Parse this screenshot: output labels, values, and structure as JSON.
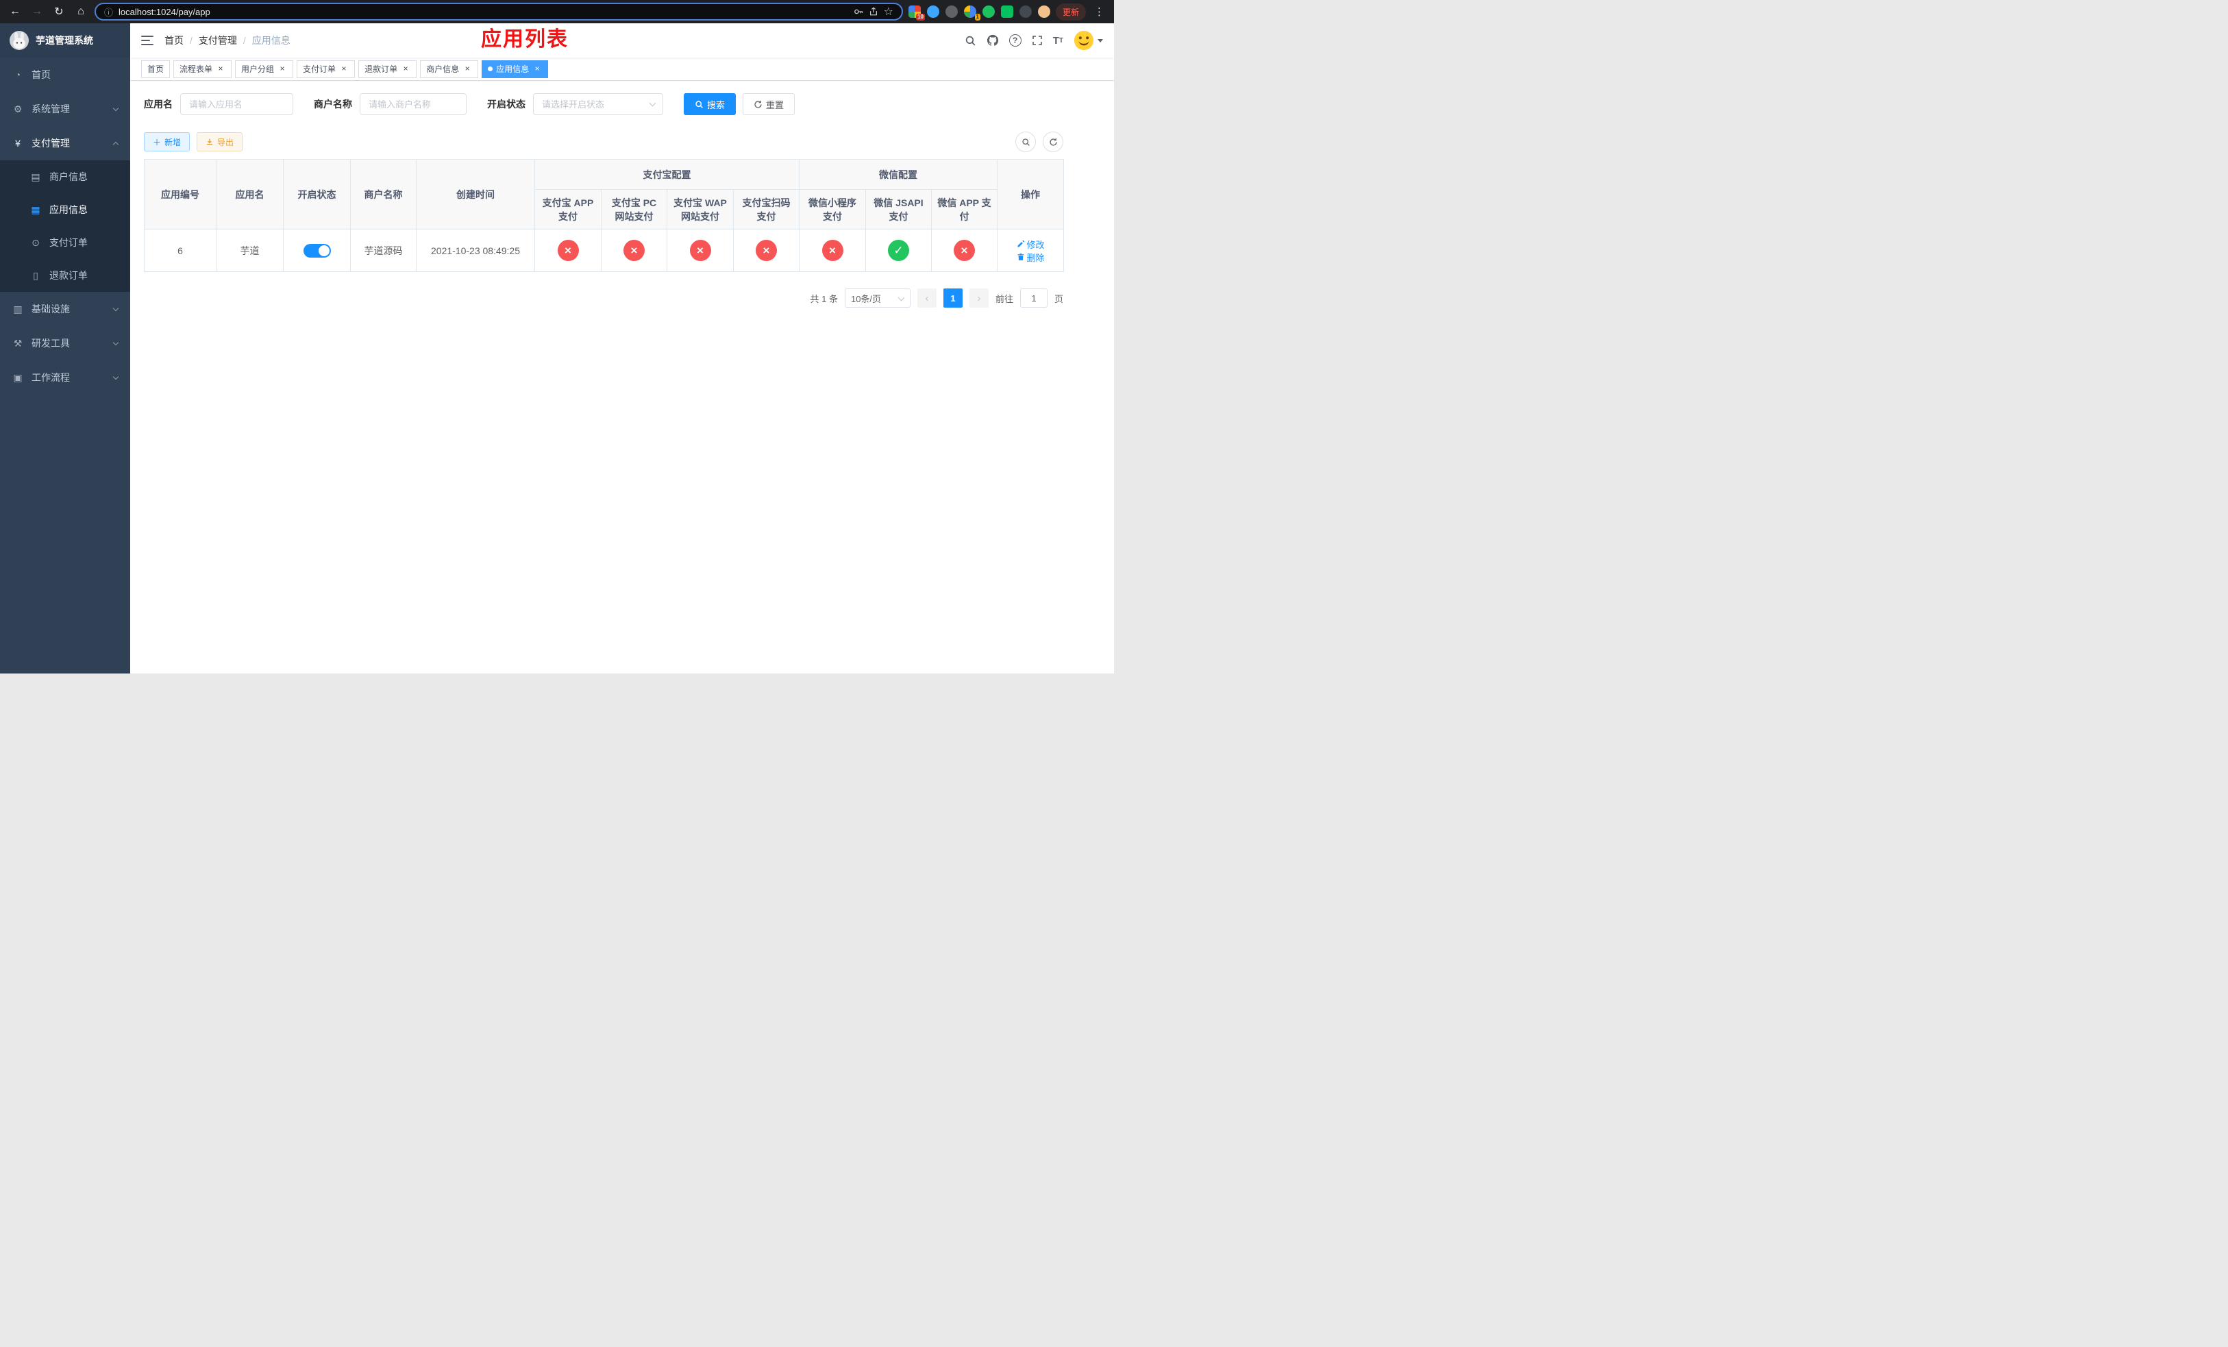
{
  "browser": {
    "url": "localhost:1024/pay/app",
    "update_label": "更新",
    "extension_badge_tabs": "10",
    "extension_badge_translate": "1"
  },
  "app": {
    "title": "芋道管理系统"
  },
  "sidebar": {
    "items": [
      {
        "label": "首页"
      },
      {
        "label": "系统管理"
      },
      {
        "label": "支付管理",
        "children": [
          {
            "label": "商户信息"
          },
          {
            "label": "应用信息"
          },
          {
            "label": "支付订单"
          },
          {
            "label": "退款订单"
          }
        ]
      },
      {
        "label": "基础设施"
      },
      {
        "label": "研发工具"
      },
      {
        "label": "工作流程"
      }
    ]
  },
  "header": {
    "breadcrumb": [
      "首页",
      "支付管理",
      "应用信息"
    ],
    "overlay_title": "应用列表"
  },
  "tabs": [
    {
      "label": "首页"
    },
    {
      "label": "流程表单"
    },
    {
      "label": "用户分组"
    },
    {
      "label": "支付订单"
    },
    {
      "label": "退款订单"
    },
    {
      "label": "商户信息"
    },
    {
      "label": "应用信息"
    }
  ],
  "filters": {
    "app_name_label": "应用名",
    "app_name_placeholder": "请输入应用名",
    "merchant_label": "商户名称",
    "merchant_placeholder": "请输入商户名称",
    "status_label": "开启状态",
    "status_placeholder": "请选择开启状态",
    "search_label": "搜索",
    "reset_label": "重置"
  },
  "toolbar": {
    "add_label": "新增",
    "export_label": "导出"
  },
  "table": {
    "columns": {
      "id": "应用编号",
      "name": "应用名",
      "status": "开启状态",
      "merchant": "商户名称",
      "created": "创建时间",
      "alipay_group": "支付宝配置",
      "alipay_app": "支付宝 APP 支付",
      "alipay_pc": "支付宝 PC 网站支付",
      "alipay_wap": "支付宝 WAP 网站支付",
      "alipay_qr": "支付宝扫码支付",
      "wechat_group": "微信配置",
      "wechat_lite": "微信小程序支付",
      "wechat_jsapi": "微信 JSAPI 支付",
      "wechat_app": "微信 APP 支付",
      "actions": "操作"
    },
    "row": {
      "id": "6",
      "name": "芋道",
      "enabled": true,
      "merchant": "芋道源码",
      "created": "2021-10-23 08:49:25",
      "alipay_app": false,
      "alipay_pc": false,
      "alipay_wap": false,
      "alipay_qr": false,
      "wechat_lite": false,
      "wechat_jsapi": true,
      "wechat_app": false,
      "edit_label": "修改",
      "delete_label": "删除"
    }
  },
  "pagination": {
    "total": "共 1 条",
    "page_size": "10条/页",
    "page": "1",
    "goto_prefix": "前往",
    "goto_value": "1",
    "goto_suffix": "页"
  },
  "icons": {
    "ok": "✓",
    "fail": "×"
  },
  "colors": {
    "primary": "#1890ff",
    "tag_active": "#409eff",
    "success": "#22c55e",
    "danger": "#f75555",
    "sidebar_bg": "#304156",
    "submenu_bg": "#1f2d3d"
  }
}
